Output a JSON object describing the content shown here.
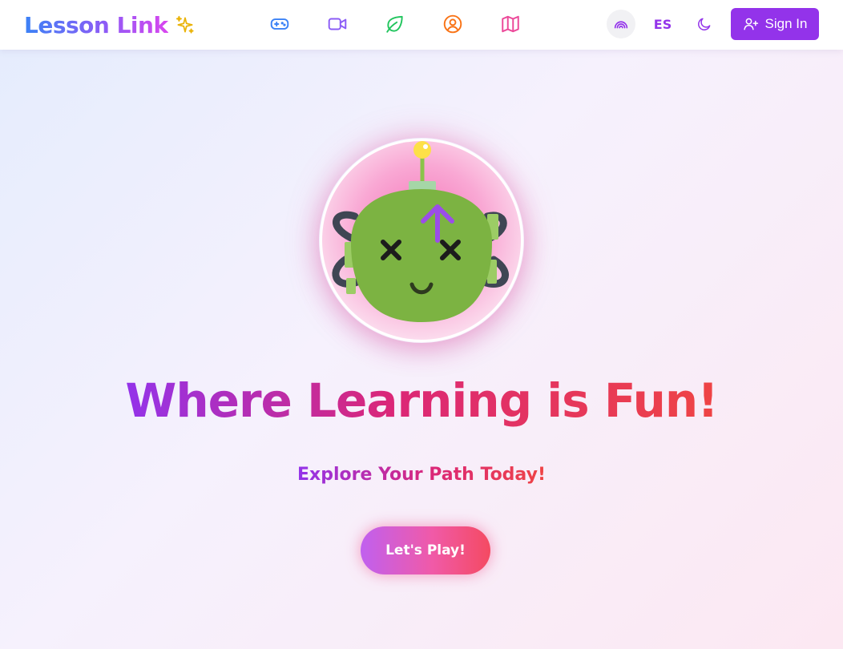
{
  "header": {
    "logo_text": "Lesson Link",
    "logo_icon": "sparkles-icon",
    "nav": [
      {
        "name": "games",
        "icon": "gamepad-icon",
        "color": "#3b82f6"
      },
      {
        "name": "videos",
        "icon": "video-camera-icon",
        "color": "#8b5cf6"
      },
      {
        "name": "nature",
        "icon": "leaf-icon",
        "color": "#22c55e"
      },
      {
        "name": "profile",
        "icon": "user-circle-icon",
        "color": "#f97316"
      },
      {
        "name": "map",
        "icon": "map-icon",
        "color": "#ec4899"
      }
    ],
    "language_label": "ES",
    "theme_icon": "moon-icon",
    "signal_icon": "rainbow-icon",
    "signin_label": "Sign In",
    "signin_icon": "user-plus-icon"
  },
  "hero": {
    "title": "Where Learning is Fun!",
    "subtitle": "Explore Your Path Today!",
    "cta_label": "Let's Play!",
    "avatar": "robot-mascot"
  },
  "colors": {
    "accent": "#9333ea",
    "gradient_start": "#9333ea",
    "gradient_mid": "#db2777",
    "gradient_end": "#ef4444",
    "robot_green": "#7cb342"
  }
}
